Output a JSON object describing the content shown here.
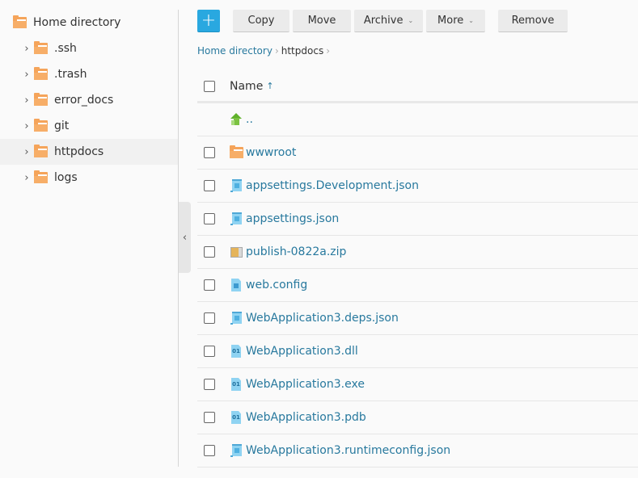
{
  "sidebar": {
    "root": {
      "label": "Home directory",
      "icon": "folder-icon"
    },
    "items": [
      {
        "label": ".ssh",
        "icon": "folder-icon",
        "selected": false
      },
      {
        "label": ".trash",
        "icon": "folder-icon",
        "selected": false
      },
      {
        "label": "error_docs",
        "icon": "folder-icon",
        "selected": false
      },
      {
        "label": "git",
        "icon": "folder-icon",
        "selected": false
      },
      {
        "label": "httpdocs",
        "icon": "folder-icon",
        "selected": true
      },
      {
        "label": "logs",
        "icon": "folder-icon",
        "selected": false
      }
    ],
    "collapse_icon": "‹"
  },
  "toolbar": {
    "add_label": "+",
    "copy_label": "Copy",
    "move_label": "Move",
    "archive_label": "Archive",
    "more_label": "More",
    "remove_label": "Remove",
    "caret": "⌄",
    "accent_color": "#29a8e0"
  },
  "breadcrumb": {
    "items": [
      {
        "label": "Home directory",
        "link": true
      },
      {
        "label": "httpdocs",
        "link": false
      }
    ],
    "separator": "›"
  },
  "table": {
    "header": {
      "name_label": "Name",
      "sort_icon": "↑",
      "sort": "ascending"
    },
    "parent_row": {
      "label": "..",
      "icon": "up-arrow-icon"
    },
    "rows": [
      {
        "name": "wwwroot",
        "type": "folder",
        "icon": "folder-icon"
      },
      {
        "name": "appsettings.Development.json",
        "type": "json",
        "icon": "json-file-icon"
      },
      {
        "name": "appsettings.json",
        "type": "json",
        "icon": "json-file-icon"
      },
      {
        "name": "publish-0822a.zip",
        "type": "zip",
        "icon": "zip-file-icon"
      },
      {
        "name": "web.config",
        "type": "doc",
        "icon": "config-file-icon"
      },
      {
        "name": "WebApplication3.deps.json",
        "type": "json",
        "icon": "json-file-icon"
      },
      {
        "name": "WebApplication3.dll",
        "type": "binary",
        "icon": "binary-file-icon",
        "icon_text": "01"
      },
      {
        "name": "WebApplication3.exe",
        "type": "binary",
        "icon": "binary-file-icon",
        "icon_text": "01"
      },
      {
        "name": "WebApplication3.pdb",
        "type": "binary",
        "icon": "binary-file-icon",
        "icon_text": "01"
      },
      {
        "name": "WebApplication3.runtimeconfig.json",
        "type": "json",
        "icon": "json-file-icon"
      }
    ]
  }
}
